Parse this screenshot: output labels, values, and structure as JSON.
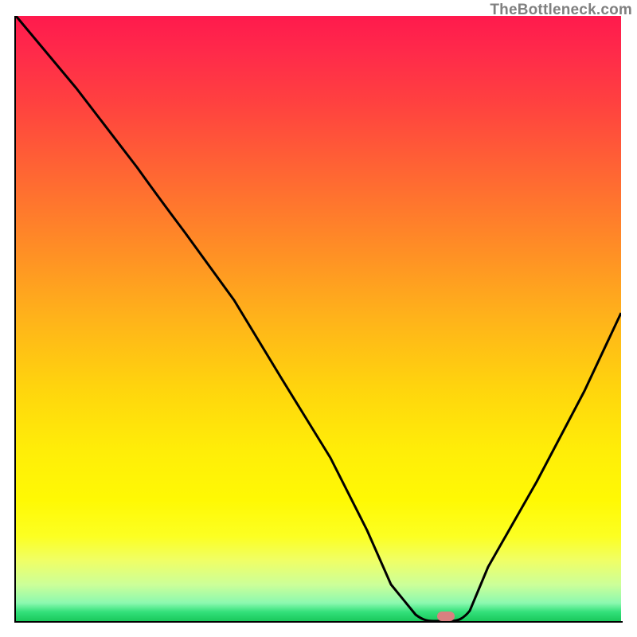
{
  "watermark": "TheBottleneck.com",
  "chart_data": {
    "type": "line",
    "title": "",
    "xlabel": "",
    "ylabel": "",
    "xlim": [
      0,
      100
    ],
    "ylim": [
      0,
      100
    ],
    "grid": false,
    "legend": false,
    "background": {
      "type": "vertical-gradient",
      "stops": [
        {
          "pos": 0,
          "color": "#ff1a4d"
        },
        {
          "pos": 50,
          "color": "#ffb31a"
        },
        {
          "pos": 80,
          "color": "#fff904"
        },
        {
          "pos": 100,
          "color": "#1ac95c"
        }
      ],
      "meaning_top": "high-bottleneck",
      "meaning_bottom": "low-bottleneck"
    },
    "series": [
      {
        "name": "bottleneck-curve",
        "color": "#000000",
        "x": [
          0,
          10,
          20,
          28,
          36,
          44,
          52,
          58,
          62,
          66,
          69,
          72,
          78,
          86,
          94,
          100
        ],
        "values": [
          100,
          88,
          75,
          65,
          53,
          40,
          27,
          15,
          6,
          1,
          0,
          0,
          9,
          23,
          38,
          49
        ]
      }
    ],
    "marker": {
      "name": "current-config",
      "x": 71,
      "y": 0,
      "color": "#d98080"
    }
  }
}
